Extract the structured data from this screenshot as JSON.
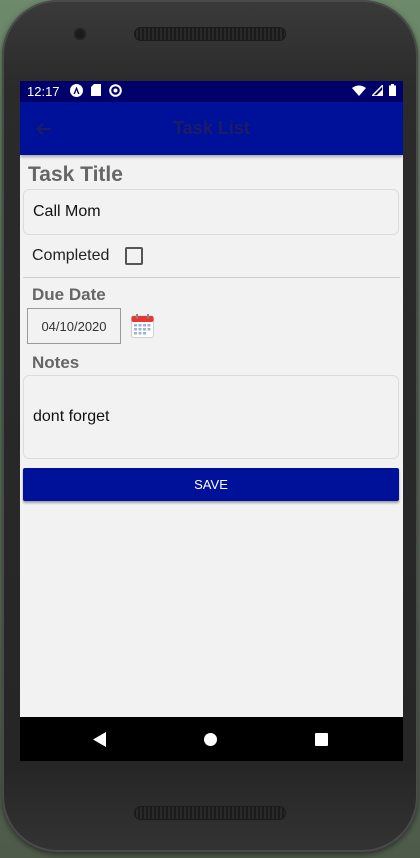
{
  "status": {
    "time": "12:17",
    "left_icons": [
      "angular-icon",
      "sd-card-icon",
      "sync-blocked-icon"
    ],
    "right_icons": [
      "wifi-icon",
      "signal-icon",
      "battery-icon"
    ]
  },
  "appbar": {
    "title": "Task List",
    "back_icon": "arrow-back-icon"
  },
  "form": {
    "title_label": "Task Title",
    "title_value": "Call Mom",
    "completed_label": "Completed",
    "completed_checked": false,
    "due_label": "Due Date",
    "due_value": "04/10/2020",
    "notes_label": "Notes",
    "notes_value": "dont forget",
    "save_label": "SAVE"
  },
  "colors": {
    "appbar": "#001199",
    "statusbar": "#00006b",
    "button": "#001199",
    "background": "#f2f2f2"
  }
}
